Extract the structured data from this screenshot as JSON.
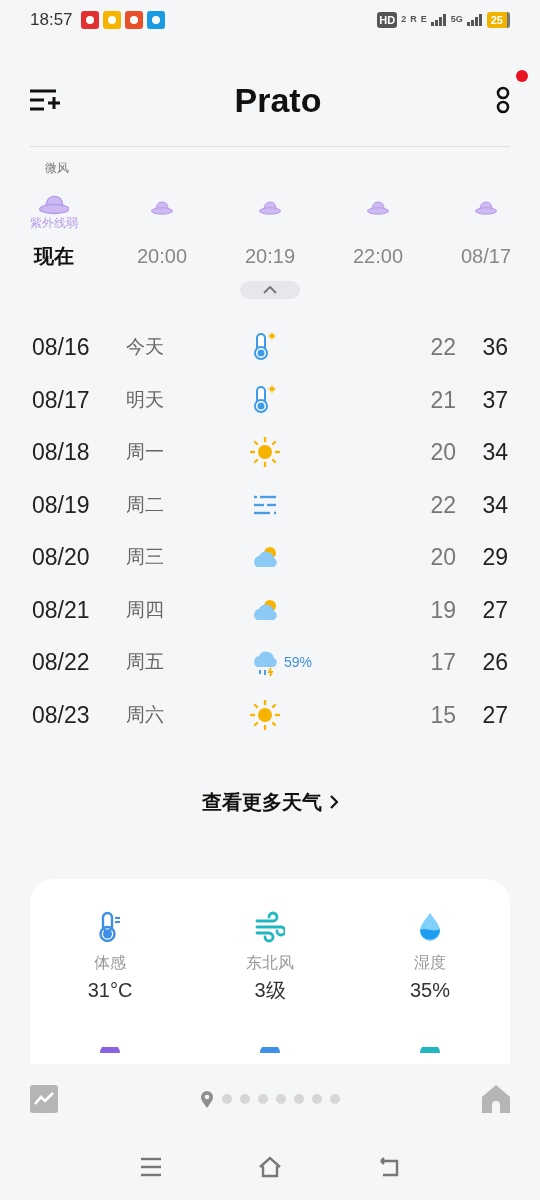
{
  "status_bar": {
    "time": "18:57",
    "network": [
      "HD",
      "2",
      "R",
      "E",
      "5G"
    ],
    "battery": "25"
  },
  "header": {
    "title": "Prato",
    "has_notification": true
  },
  "partial_row": {
    "label": "微风"
  },
  "hourly": [
    {
      "time": "现在",
      "uv_label": "紫外线弱",
      "selected": true
    },
    {
      "time": "20:00",
      "selected": false
    },
    {
      "time": "20:19",
      "selected": false
    },
    {
      "time": "22:00",
      "selected": false
    },
    {
      "time": "08/17",
      "selected": false
    }
  ],
  "daily": [
    {
      "date": "08/16",
      "day": "今天",
      "kind": "hot",
      "low": "22",
      "high": "36"
    },
    {
      "date": "08/17",
      "day": "明天",
      "kind": "hot",
      "low": "21",
      "high": "37"
    },
    {
      "date": "08/18",
      "day": "周一",
      "kind": "sunny",
      "low": "20",
      "high": "34"
    },
    {
      "date": "08/19",
      "day": "周二",
      "kind": "haze",
      "low": "22",
      "high": "34"
    },
    {
      "date": "08/20",
      "day": "周三",
      "kind": "cloudy",
      "low": "20",
      "high": "29"
    },
    {
      "date": "08/21",
      "day": "周四",
      "kind": "cloudy",
      "low": "19",
      "high": "27"
    },
    {
      "date": "08/22",
      "day": "周五",
      "kind": "storm",
      "precip": "59%",
      "low": "17",
      "high": "26"
    },
    {
      "date": "08/23",
      "day": "周六",
      "kind": "sunny",
      "low": "15",
      "high": "27"
    }
  ],
  "more_link": "查看更多天气",
  "details": [
    {
      "kind": "feels",
      "label": "体感",
      "value": "31°C"
    },
    {
      "kind": "wind",
      "label": "东北风",
      "value": "3级"
    },
    {
      "kind": "humidity",
      "label": "湿度",
      "value": "35%"
    }
  ],
  "pages": [
    {
      "kind": "location",
      "selected": true
    },
    {
      "kind": "city",
      "selected": false
    },
    {
      "kind": "city",
      "selected": false
    },
    {
      "kind": "city",
      "selected": false
    },
    {
      "kind": "city",
      "selected": false
    },
    {
      "kind": "city",
      "selected": false
    },
    {
      "kind": "city",
      "selected": false
    },
    {
      "kind": "city",
      "selected": false
    }
  ]
}
